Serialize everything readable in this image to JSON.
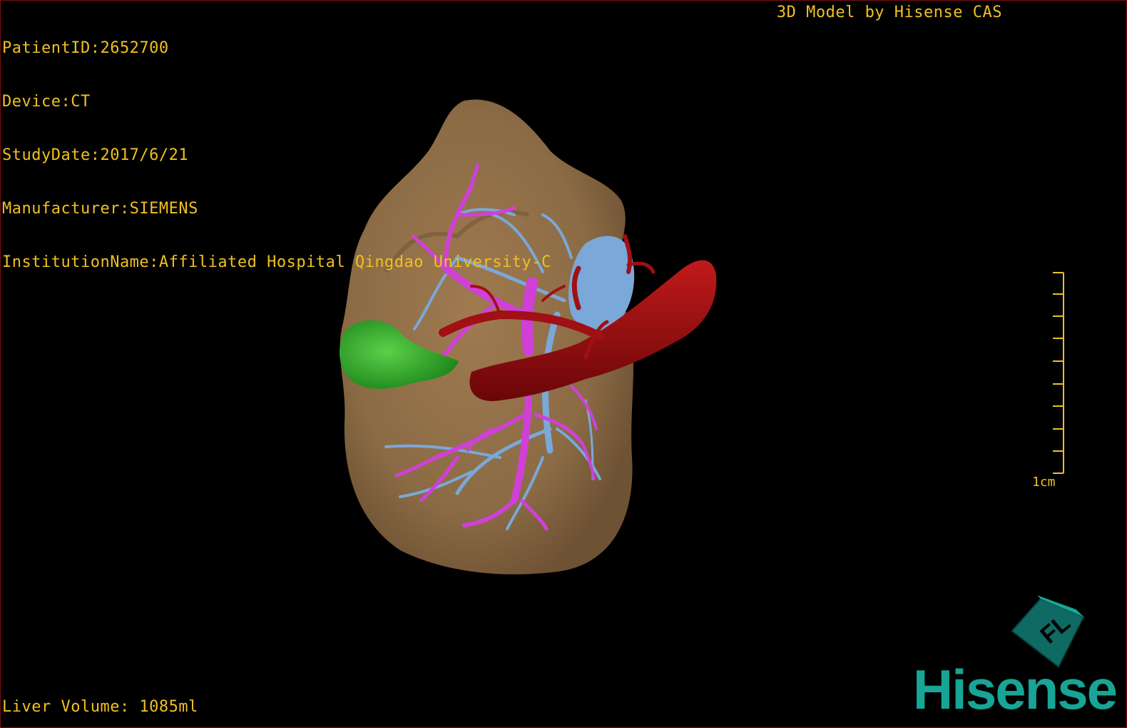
{
  "overlay": {
    "patient_id": "PatientID:2652700",
    "device": "Device:CT",
    "study_date": "StudyDate:2017/6/21",
    "manufacturer": "Manufacturer:SIEMENS",
    "institution": "InstitutionName:Affiliated Hospital Qingdao University-C",
    "brand_credit": "3D Model by Hisense CAS",
    "liver_volume": "Liver Volume: 1085ml"
  },
  "scale_bar": {
    "label": "1cm"
  },
  "logo": {
    "word": "Hisense",
    "cube_letters": "FL"
  },
  "colors": {
    "overlay_text": "#f0c020",
    "liver": "#8b6b45",
    "portal_vein": "#d040d8",
    "hepatic_vein": "#7aa8d8",
    "artery": "#9a0a10",
    "gallbladder": "#2ea82a",
    "brand": "#17a596"
  }
}
